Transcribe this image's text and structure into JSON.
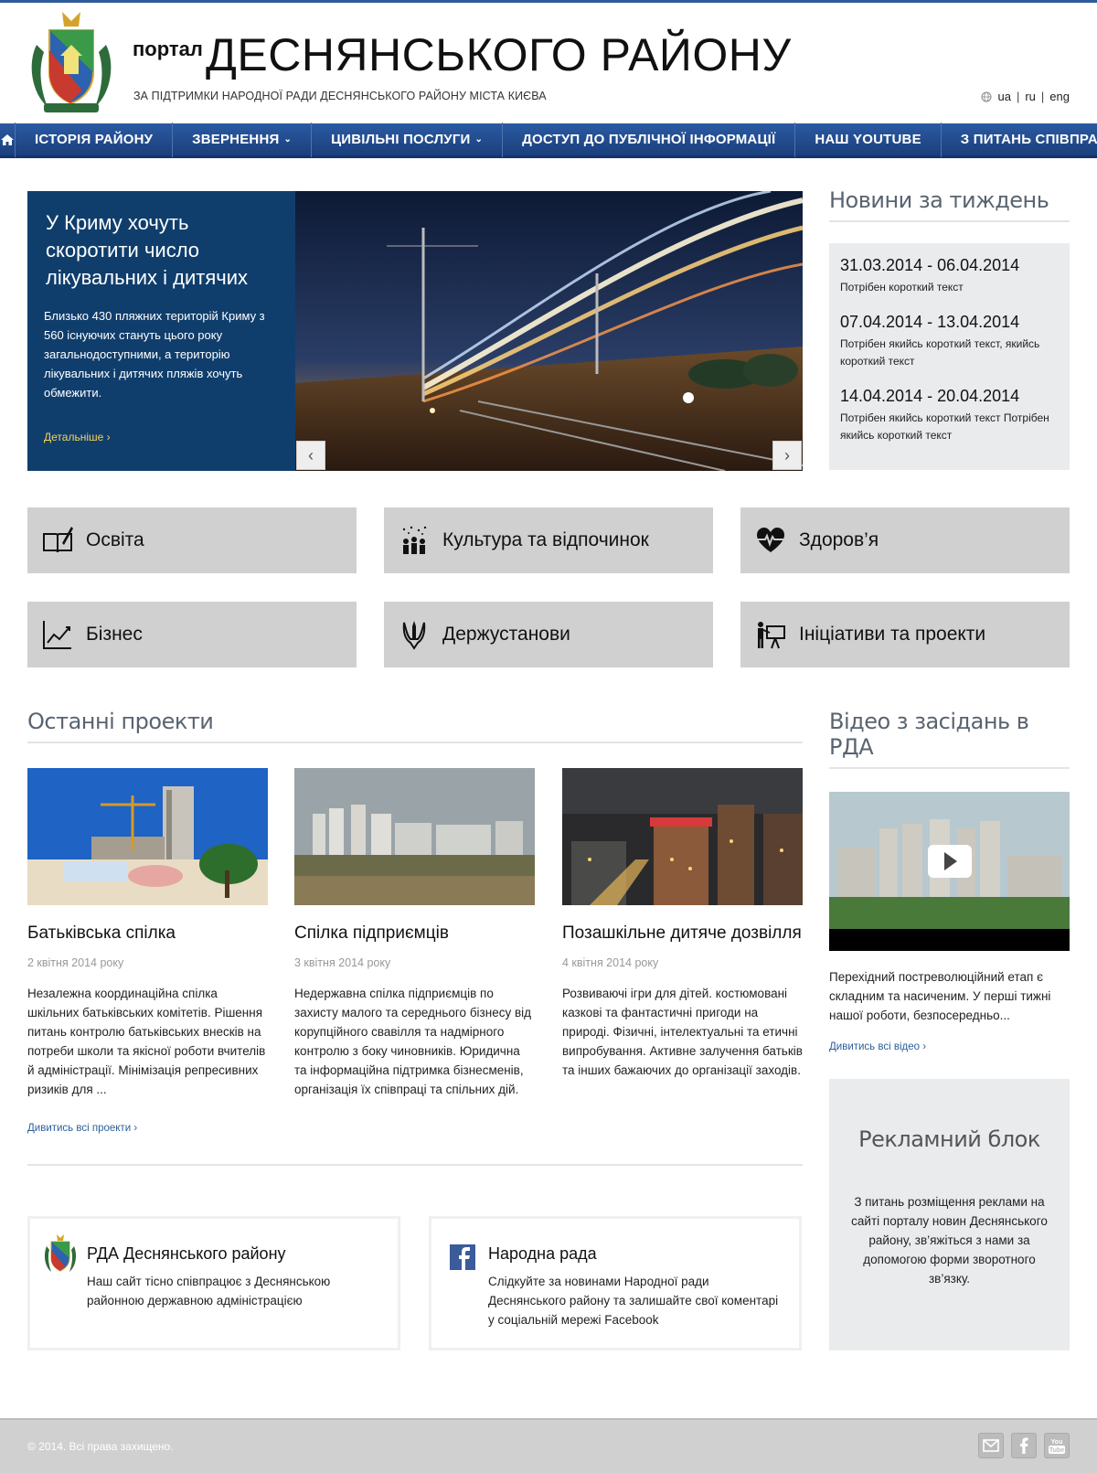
{
  "header": {
    "portal_small": "портал",
    "portal_title": "ДЕСНЯНСЬКОГО РАЙОНУ",
    "subtitle": "ЗА ПІДТРИМКИ НАРОДНОЇ РАДИ ДЕСНЯНСЬКОГО РАЙОНУ МІСТА КИЄВА",
    "languages": [
      "ua",
      "ru",
      "eng"
    ]
  },
  "nav": {
    "items": [
      {
        "label": "ІСТОРІЯ РАЙОНУ",
        "dropdown": false
      },
      {
        "label": "ЗВЕРНЕННЯ",
        "dropdown": true
      },
      {
        "label": "ЦИВІЛЬНІ ПОСЛУГИ",
        "dropdown": true
      },
      {
        "label": "ДОСТУП ДО ПУБЛІЧНОЇ ІНФОРМАЦІЇ",
        "dropdown": false
      },
      {
        "label": "НАШ YOUTUBE",
        "dropdown": false
      },
      {
        "label": "З ПИТАНЬ СПІВПРАЦІ",
        "dropdown": false
      }
    ]
  },
  "slider": {
    "title": "У Криму хочуть скоротити число лікувальних і дитячих",
    "description": "Близько 430 пляжних територій Криму з 560 існуючих стануть цього року загальнодоступними, а територію лікувальних і дитячих пляжів хочуть обмежити.",
    "more": "Детальніше"
  },
  "week": {
    "title": "Новини за тиждень",
    "entries": [
      {
        "date": "31.03.2014 - 06.04.2014",
        "text": "Потрібен короткий текст"
      },
      {
        "date": "07.04.2014 - 13.04.2014",
        "text": "Потрібен якийсь короткий текст, якийсь короткий текст"
      },
      {
        "date": "14.04.2014 - 20.04.2014",
        "text": "Потрібен якийсь короткий текст Потрібен якийсь короткий текст"
      }
    ]
  },
  "categories": {
    "education": "Освіта",
    "culture": "Культура та відпочинок",
    "health": "Здоров’я",
    "business": "Бізнес",
    "institutions": "Держустанови",
    "initiatives": "Ініціативи та проекти"
  },
  "projects": {
    "title": "Останні проекти",
    "items": [
      {
        "title": "Батьківська спілка",
        "date": "2 квітня 2014 року",
        "text": "Незалежна координаційна спілка шкільних батьківських комітетів. Рішення питань контролю батьківських внесків на потреби школи та якісної роботи вчителів й адміністрації. Мінімізація репресивних ризиків для ..."
      },
      {
        "title": "Спілка підприємців",
        "date": "3 квітня 2014 року",
        "text": "Недержавна спілка підприємців по захисту малого та середнього бізнесу від корупційного свавілля та надмірного контролю з боку чиновників. Юридична та інформаційна підтримка бізнесменів, організація їх співпраці та спільних дій."
      },
      {
        "title": "Позашкільне дитяче дозвілля",
        "date": "4 квітня 2014 року",
        "text": "Розвиваючі ігри для дітей. костюмовані казкові та фантастичні пригоди на природі. Фізичні, інтелектуальні та етичні випробування. Активне залучення батьків та інших бажаючих до організації заходів."
      }
    ],
    "more": "Дивитись всі проекти"
  },
  "video": {
    "title": "Відео з засідань в РДА",
    "text": "Перехідний постреволюційний етап є складним та насиченим. У перші тижні нашої роботи, безпосередньо...",
    "more": "Дивитись всі відео"
  },
  "ad": {
    "title": "Рекламний блок",
    "text": "З питань розміщення реклами на сайті порталу новин Деснянського району, зв’яжіться з нами за допомогою форми зворотного зв’язку."
  },
  "social": {
    "rda": {
      "title": "РДА Деснянського району",
      "text": "Наш сайт тісно співпрацює з Деснянською районною державною адміністрацією"
    },
    "rada": {
      "title": "Народна рада",
      "text": "Слідкуйте за новинами Народної ради Деснянського району та залишайте свої коментарі у соціальній мережі Facebook"
    }
  },
  "footer": {
    "copyright": "© 2014. Всі права захищено.",
    "icons": [
      "mail-icon",
      "facebook-icon",
      "youtube-icon"
    ]
  },
  "colors": {
    "nav": "#1f4a8c",
    "slide_bg": "#103e6c",
    "link": "#2c5f9a",
    "more_yellow": "#f3d25c",
    "tile_bg": "#d0d0d0"
  }
}
